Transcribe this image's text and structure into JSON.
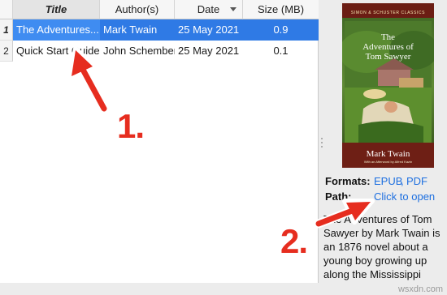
{
  "table": {
    "columns": {
      "title": "Title",
      "author": "Author(s)",
      "date": "Date",
      "size": "Size (MB)"
    },
    "rows": [
      {
        "num": "1",
        "title": "The Adventures...",
        "author": "Mark Twain",
        "date": "25 May 2021",
        "size": "0.9"
      },
      {
        "num": "2",
        "title": "Quick Start Guide",
        "author": "John Schember",
        "date": "25 May 2021",
        "size": "0.1"
      }
    ]
  },
  "cover": {
    "series": "Simon & Schuster Classics",
    "title_line1": "The",
    "title_line2": "Adventures of",
    "title_line3": "Tom Sawyer",
    "author": "Mark Twain",
    "note": "With an Afterword by Alfred Kazin"
  },
  "details": {
    "formats_label": "Formats:",
    "formats": [
      "EPUB",
      "PDF"
    ],
    "path_label": "Path:",
    "path_link": "Click to open",
    "description": "The Adventures of Tom Sawyer by Mark Twain is an 1876 novel about a young boy growing up along the Mississippi"
  },
  "annotations": {
    "step1": "1.",
    "step2": "2."
  },
  "watermark": "wsxdn.com",
  "colors": {
    "selection": "#2f7ae5",
    "link": "#1d6fe0",
    "annotation": "#e62d1f"
  }
}
